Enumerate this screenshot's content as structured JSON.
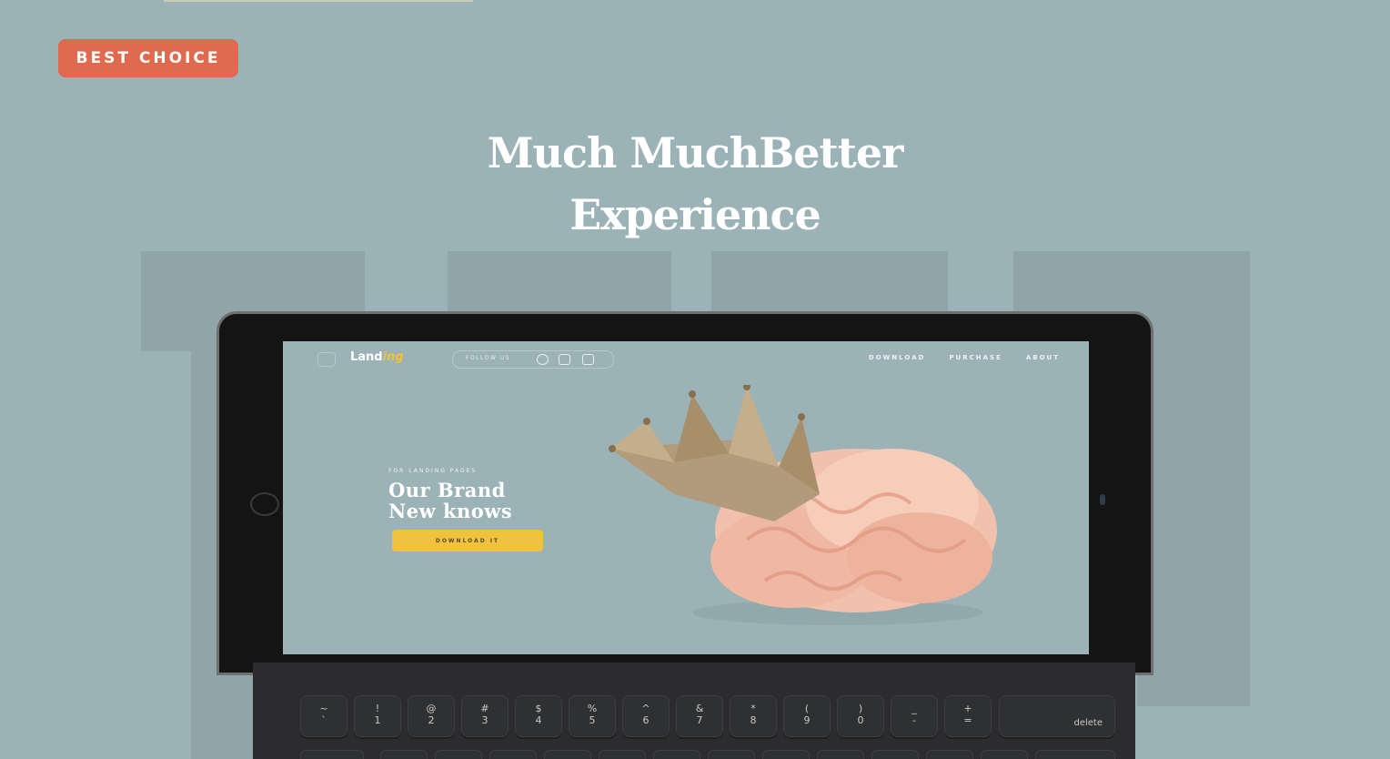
{
  "badge": {
    "label": "BEST CHOICE"
  },
  "headline": {
    "line1": "Much MuchBetter",
    "line2": "Experience"
  },
  "screen": {
    "logo_main": "Land",
    "logo_accent": "ing",
    "follow_label": "FOLLOW US",
    "nav_links": [
      "DOWNLOAD",
      "PURCHASE",
      "ABOUT"
    ],
    "eyebrow": "FOR LANDING PAGES",
    "title_line1": "Our Brand",
    "title_line2": "New knows",
    "button_label": "DOWNLOAD IT"
  },
  "keyboard": {
    "keys": [
      {
        "top": "~",
        "bottom": "`"
      },
      {
        "top": "!",
        "bottom": "1"
      },
      {
        "top": "@",
        "bottom": "2"
      },
      {
        "top": "#",
        "bottom": "3"
      },
      {
        "top": "$",
        "bottom": "4"
      },
      {
        "top": "%",
        "bottom": "5"
      },
      {
        "top": "^",
        "bottom": "6"
      },
      {
        "top": "&",
        "bottom": "7"
      },
      {
        "top": "*",
        "bottom": "8"
      },
      {
        "top": "(",
        "bottom": "9"
      },
      {
        "top": ")",
        "bottom": "0"
      },
      {
        "top": "_",
        "bottom": "-"
      },
      {
        "top": "+",
        "bottom": "="
      }
    ],
    "delete_label": "delete"
  },
  "colors": {
    "background": "#9bb3b6",
    "badge": "#e06a4f",
    "accent": "#f0c23d"
  }
}
